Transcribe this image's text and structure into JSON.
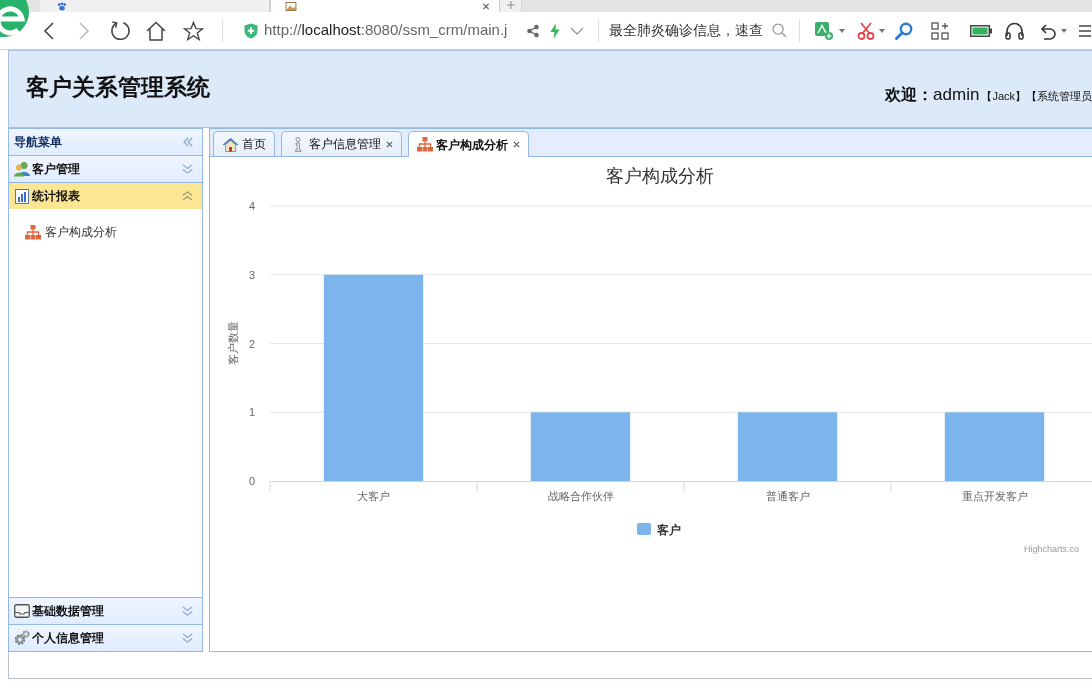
{
  "browser": {
    "tabs": [
      {
        "selected": false
      },
      {
        "selected": true
      }
    ],
    "address": {
      "scheme": "http://",
      "host": "localhost",
      "path": ":8080/ssm_crm/main.j"
    },
    "search": {
      "placeholder": "最全肺炎确诊信息，速查"
    }
  },
  "header": {
    "title": "客户关系管理系统",
    "welcome_label": "欢迎：",
    "user": "admin",
    "name": "【Jack】",
    "role": "【系统管理员"
  },
  "sidebar": {
    "title": "导航菜单",
    "panels": [
      {
        "label": "客户管理",
        "expanded": false
      },
      {
        "label": "统计报表",
        "expanded": true,
        "items": [
          {
            "label": "客户构成分析"
          }
        ]
      },
      {
        "label": "基础数据管理",
        "expanded": false
      },
      {
        "label": "个人信息管理",
        "expanded": false
      }
    ]
  },
  "tabs": [
    {
      "label": "首页",
      "closable": false,
      "selected": false
    },
    {
      "label": "客户信息管理",
      "closable": true,
      "selected": false
    },
    {
      "label": "客户构成分析",
      "closable": true,
      "selected": true
    }
  ],
  "chart": {
    "chart_data": {
      "type": "bar",
      "orientation": "vertical",
      "grid": true,
      "title": "客户构成分析",
      "ylabel": "客户数量",
      "categories": [
        "大客户",
        "战略合作伙伴",
        "普通客户",
        "重点开发客户"
      ],
      "series": [
        {
          "name": "客户",
          "color": "#7cb5ec",
          "values": [
            3,
            1,
            1,
            1
          ]
        }
      ],
      "ylim": [
        0,
        4
      ],
      "yticks": [
        0,
        1,
        2,
        3,
        4
      ]
    },
    "credits": "Highcharts.co"
  }
}
